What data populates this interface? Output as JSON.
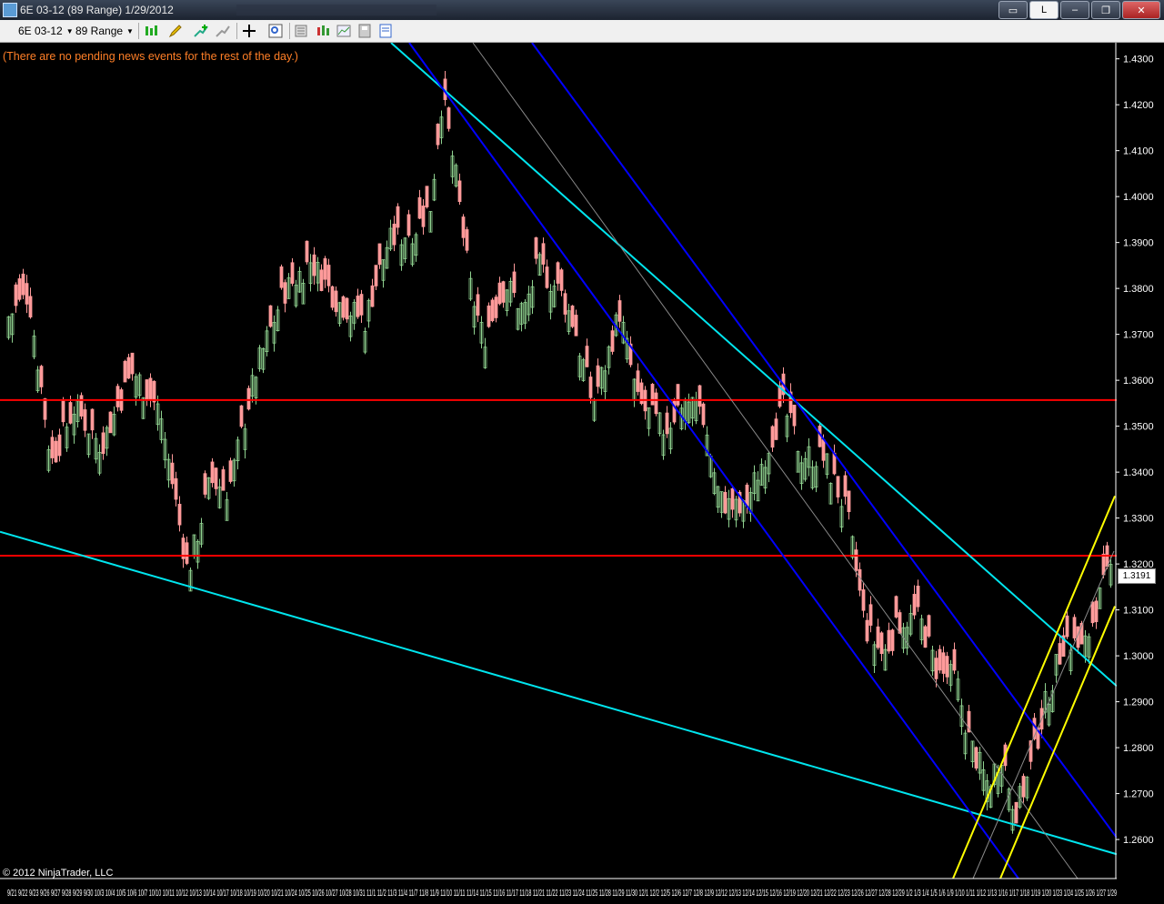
{
  "window": {
    "title": "6E 03-12 (89 Range)  1/29/2012",
    "layout_button": "L"
  },
  "toolbar": {
    "instrument": "6E 03-12",
    "period": "89 Range"
  },
  "news_message": "(There are no pending news events for the rest of the day.)",
  "copyright": "© 2012 NinjaTrader, LLC",
  "colors": {
    "background": "#000000",
    "up_candle": "#8fd18f",
    "down_candle": "#ff9a9a",
    "support_line": "#ff0000",
    "outer_channel": "#00e5ee",
    "mid_channel": "#0000ff",
    "rising_channel": "#ffff00",
    "news_text": "#ff7f27"
  },
  "chart_data": {
    "type": "candlestick",
    "instrument": "6E 03-12",
    "period": "89 Range",
    "y_ticks": [
      1.26,
      1.27,
      1.28,
      1.29,
      1.3,
      1.31,
      1.32,
      1.33,
      1.34,
      1.35,
      1.36,
      1.37,
      1.38,
      1.39,
      1.4,
      1.41,
      1.42,
      1.43
    ],
    "y_tick_labels": [
      "1.2600",
      "1.2700",
      "1.2800",
      "1.2900",
      "1.3000",
      "1.3100",
      "1.3200",
      "1.3300",
      "1.3400",
      "1.3500",
      "1.3600",
      "1.3700",
      "1.3800",
      "1.3900",
      "1.4000",
      "1.4100",
      "1.4200",
      "1.4300"
    ],
    "ylim": [
      1.2515,
      1.4335
    ],
    "last_price": "1.3191",
    "x_label_text": "9/21   9/22   9/23 9/26   9/27 9/28 9/29 9/30 10/3 10/4 10/5 10/6 10/7 10/10 10/11 10/12 10/13 10/14 10/17 10/18 10/19 10/20 10/21 10/24 10/25 10/26 10/27 10/28 10/31 11/1   11/2 11/3   11/4 11/7 11/8 11/9 11/10 11/11 11/14 11/15 11/16 11/17 11/18 11/21 11/22 11/23 11/24 11/25 11/28 11/29 11/30   12/1 12/2 12/5 12/6 12/7 12/8 12/9 12/12 12/13 12/14 12/15 12/16 12/19 12/20 12/21 12/22 12/23 12/26 12/27 12/28 12/29 1/2 1/3 1/4 1/5 1/6 1/9 1/10 1/11 1/12 1/13 1/16 1/17 1/18 1/19 1/20 1/23 1/24 1/25 1/26 1/27 1/29",
    "anchors": [
      [
        0,
        1.372
      ],
      [
        30,
        1.379
      ],
      [
        55,
        1.342
      ],
      [
        80,
        1.354
      ],
      [
        110,
        1.346
      ],
      [
        145,
        1.362
      ],
      [
        175,
        1.353
      ],
      [
        205,
        1.318
      ],
      [
        230,
        1.338
      ],
      [
        250,
        1.336
      ],
      [
        280,
        1.362
      ],
      [
        310,
        1.379
      ],
      [
        340,
        1.386
      ],
      [
        370,
        1.377
      ],
      [
        400,
        1.373
      ],
      [
        425,
        1.39
      ],
      [
        455,
        1.393
      ],
      [
        472,
        1.398
      ],
      [
        485,
        1.422
      ],
      [
        500,
        1.404
      ],
      [
        515,
        1.381
      ],
      [
        530,
        1.369
      ],
      [
        555,
        1.381
      ],
      [
        575,
        1.375
      ],
      [
        590,
        1.385
      ],
      [
        615,
        1.379
      ],
      [
        630,
        1.372
      ],
      [
        650,
        1.355
      ],
      [
        665,
        1.364
      ],
      [
        680,
        1.375
      ],
      [
        700,
        1.355
      ],
      [
        730,
        1.349
      ],
      [
        750,
        1.356
      ],
      [
        770,
        1.354
      ],
      [
        790,
        1.334
      ],
      [
        815,
        1.331
      ],
      [
        840,
        1.344
      ],
      [
        860,
        1.354
      ],
      [
        880,
        1.344
      ],
      [
        905,
        1.343
      ],
      [
        930,
        1.331
      ],
      [
        950,
        1.306
      ],
      [
        970,
        1.3
      ],
      [
        990,
        1.308
      ],
      [
        1010,
        1.308
      ],
      [
        1030,
        1.296
      ],
      [
        1050,
        1.295
      ],
      [
        1065,
        1.281
      ],
      [
        1085,
        1.272
      ],
      [
        1100,
        1.279
      ],
      [
        1115,
        1.266
      ],
      [
        1130,
        1.274
      ],
      [
        1150,
        1.291
      ],
      [
        1170,
        1.304
      ],
      [
        1190,
        1.301
      ],
      [
        1205,
        1.311
      ],
      [
        1220,
        1.319
      ]
    ],
    "horizontal_levels": [
      1.3557,
      1.3218
    ],
    "trend_lines": [
      {
        "color": "outer_channel",
        "p1": [
          430,
          1.4335
        ],
        "p2": [
          1228,
          1.2934
        ]
      },
      {
        "color": "outer_channel",
        "p1": [
          0,
          1.327
        ],
        "p2": [
          1228,
          1.2568
        ]
      },
      {
        "color": "mid_channel",
        "p1": [
          450,
          1.4335
        ],
        "p2": [
          1120,
          1.2515
        ]
      },
      {
        "color": "mid_channel",
        "p1": [
          585,
          1.4335
        ],
        "p2": [
          1228,
          1.2604
        ]
      },
      {
        "color": "thin_gray",
        "p1": [
          520,
          1.4335
        ],
        "p2": [
          1185,
          1.2515
        ]
      },
      {
        "color": "rising_channel",
        "p1": [
          1048,
          1.2515
        ],
        "p2": [
          1226,
          1.3348
        ]
      },
      {
        "color": "rising_channel",
        "p1": [
          1100,
          1.2515
        ],
        "p2": [
          1226,
          1.3108
        ]
      },
      {
        "color": "thin_gray",
        "p1": [
          1070,
          1.2515
        ],
        "p2": [
          1225,
          1.3228
        ]
      }
    ]
  }
}
